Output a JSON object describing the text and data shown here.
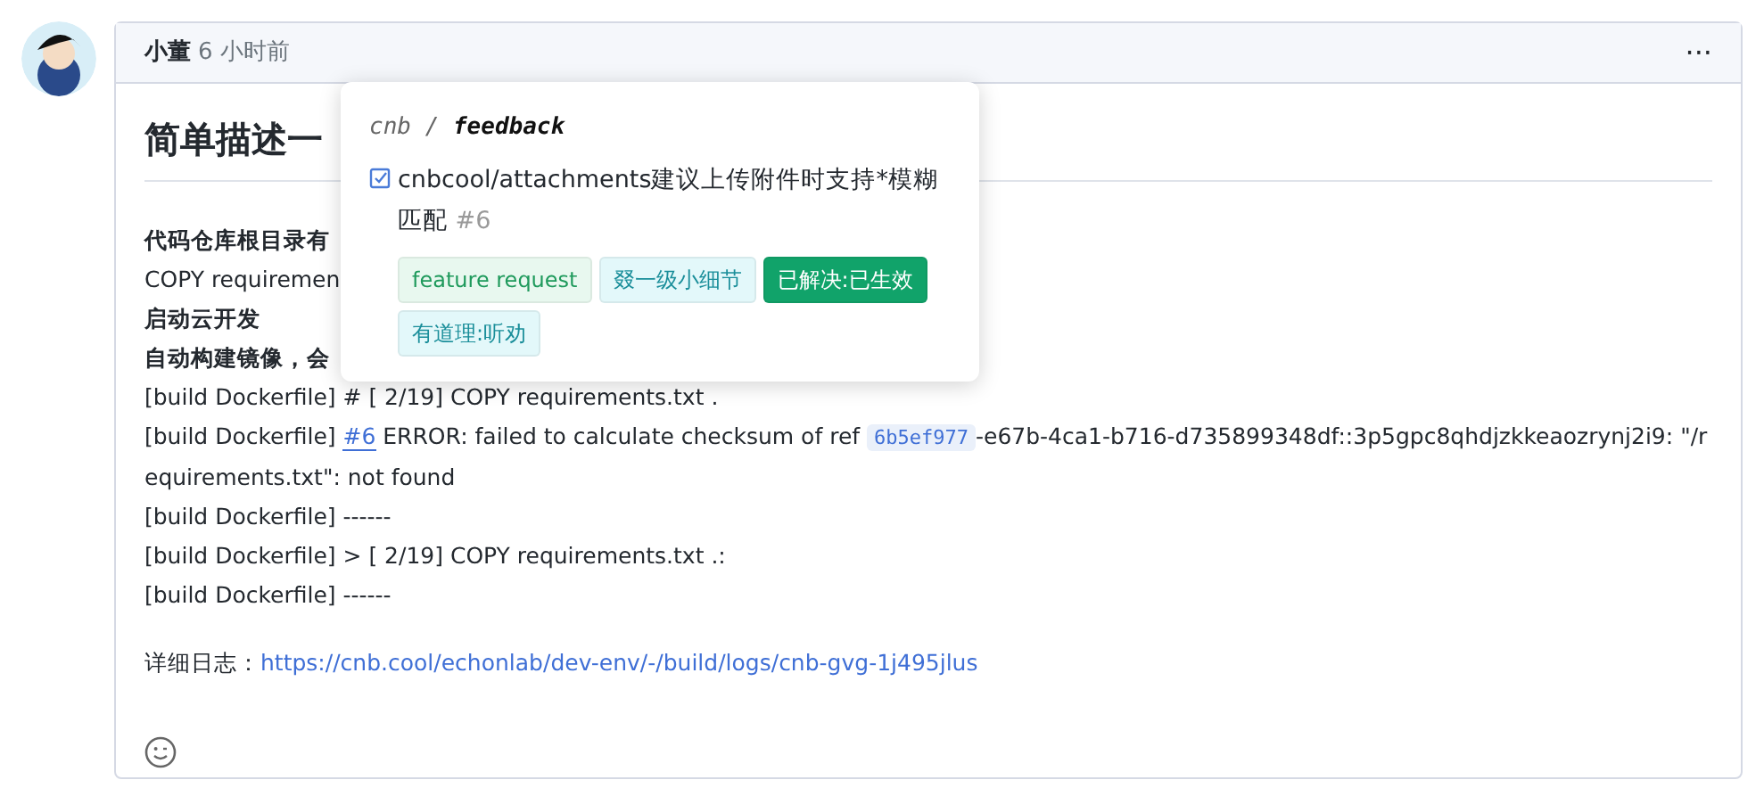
{
  "comment": {
    "author": "小董",
    "time": "6 小时前",
    "menu": "···",
    "title": "简单描述一",
    "lines": [
      {
        "kind": "bold",
        "text": "代码仓库根目录有"
      },
      {
        "kind": "plain",
        "text": "COPY requiremen"
      },
      {
        "kind": "bold",
        "text": "启动云开发"
      },
      {
        "kind": "bold",
        "text": "自动构建镜像，会"
      },
      {
        "kind": "log",
        "text": "[build Dockerfile] # [ 2/19] COPY requirements.txt ."
      },
      {
        "kind": "error",
        "prefix": "[build Dockerfile]",
        "ref": "#6",
        "text": "ERROR: failed to calculate checksum of ref",
        "code": "6b5ef977",
        "rest": "-e67b-4ca1-b716-d735899348df::3p5gpc8qhdjzkkeaozrynj2i9: \"/requirements.txt\": not found"
      },
      {
        "kind": "log",
        "text": "[build Dockerfile] ------"
      },
      {
        "kind": "log",
        "text": "[build Dockerfile] > [ 2/19] COPY requirements.txt .:"
      },
      {
        "kind": "log",
        "text": "[build Dockerfile] ------"
      }
    ],
    "log_label": "详细日志：",
    "log_link": "https://cnb.cool/echonlab/dev-env/-/build/logs/cnb-gvg-1j495jlus"
  },
  "popover": {
    "org": "cnb",
    "separator": "/",
    "repo": "feedback",
    "issue_title": "cnbcool/attachments建议上传附件时支持*模糊匹配",
    "issue_number": "#6",
    "labels": [
      {
        "text": "feature request",
        "color": "#e8f8ef"
      },
      {
        "text": "叕一级小细节",
        "color": "#e3f8fa"
      },
      {
        "text": "已解决:已生效",
        "color": "#11a36a"
      },
      {
        "text": "有道理:听劝",
        "color": "#e3f8fa"
      }
    ]
  }
}
